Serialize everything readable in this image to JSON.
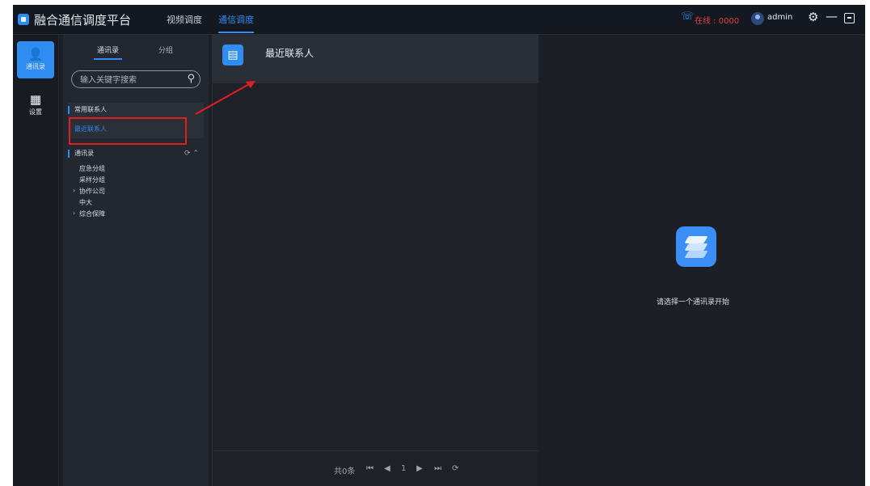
{
  "app": {
    "title": "融合通信调度平台",
    "nav": [
      "视频调度",
      "通信调度"
    ],
    "status": "在线 : 0000",
    "user": "admin"
  },
  "rail": {
    "items": [
      {
        "label": "通讯录",
        "icon": "contacts-icon"
      },
      {
        "label": "设置",
        "icon": "building-icon"
      }
    ]
  },
  "sidebar": {
    "tabs": [
      "通讯录",
      "分组"
    ],
    "search_placeholder": "输入关键字搜索",
    "group_common": "常用联系人",
    "recent_contacts": "最近联系人",
    "group_directory": "通讯录",
    "directory_items": [
      {
        "label": "应急分组",
        "expandable": false
      },
      {
        "label": "采样分组",
        "expandable": false
      },
      {
        "label": "协作公司",
        "expandable": true
      },
      {
        "label": "中大",
        "expandable": false
      },
      {
        "label": "综合保障",
        "expandable": true
      }
    ]
  },
  "center": {
    "title": "最近联系人",
    "pager": {
      "summary": "共0条",
      "page": "1"
    }
  },
  "right": {
    "hint": "请选择一个通讯录开始"
  },
  "colors": {
    "accent": "#2f8cf0",
    "highlight_box": "#e02020",
    "background": "#1c1f26"
  }
}
